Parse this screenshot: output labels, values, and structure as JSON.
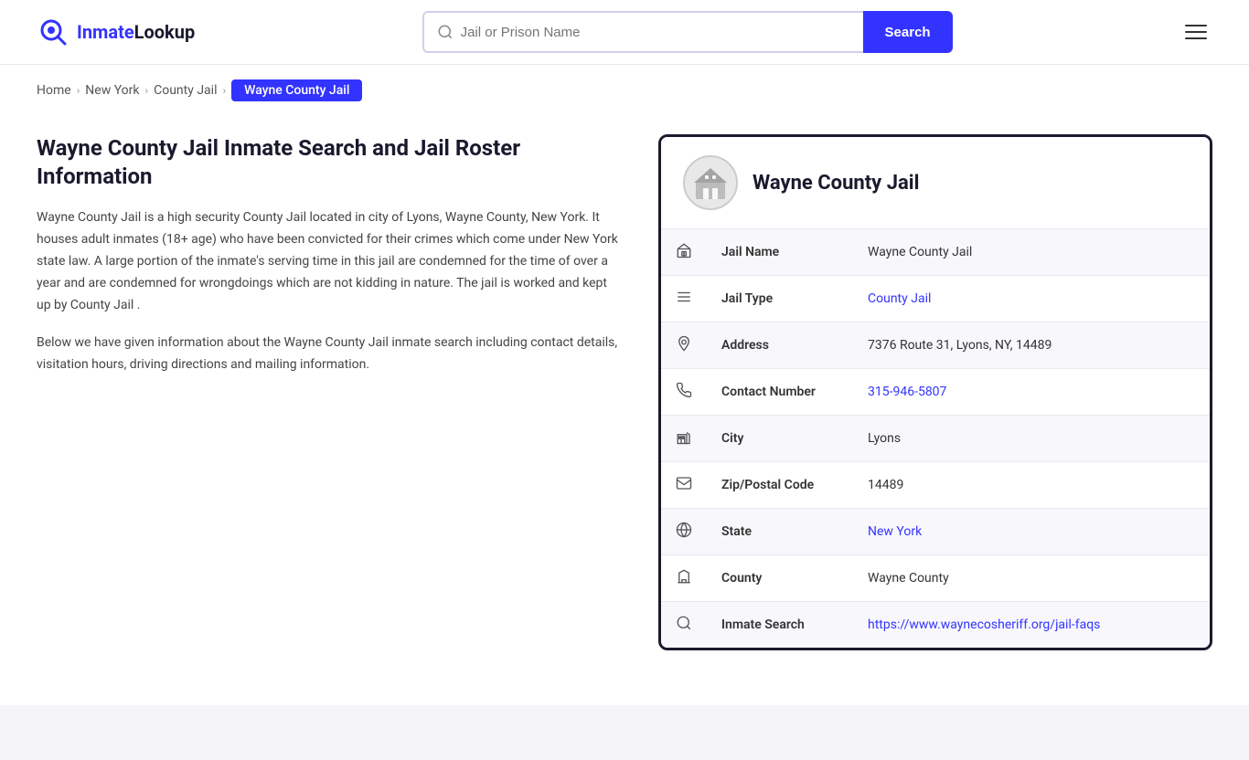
{
  "header": {
    "logo_text_blue": "Inmate",
    "logo_text_dark": "Lookup",
    "search_placeholder": "Jail or Prison Name",
    "search_button_label": "Search",
    "menu_icon": "menu-icon"
  },
  "breadcrumb": {
    "home_label": "Home",
    "state_label": "New York",
    "type_label": "County Jail",
    "current_label": "Wayne County Jail"
  },
  "left": {
    "title": "Wayne County Jail Inmate Search and Jail Roster Information",
    "desc1": "Wayne County Jail is a high security County Jail located in city of Lyons, Wayne County, New York. It houses adult inmates (18+ age) who have been convicted for their crimes which come under New York state law. A large portion of the inmate's serving time in this jail are condemned for the time of over a year and are condemned for wrongdoings which are not kidding in nature. The jail is worked and kept up by County Jail .",
    "desc2": "Below we have given information about the Wayne County Jail inmate search including contact details, visitation hours, driving directions and mailing information."
  },
  "card": {
    "jail_name_header": "Wayne County Jail",
    "rows": [
      {
        "label": "Jail Name",
        "value": "Wayne County Jail",
        "link": false,
        "icon": "jail-icon"
      },
      {
        "label": "Jail Type",
        "value": "County Jail",
        "link": true,
        "link_url": "#",
        "icon": "list-icon"
      },
      {
        "label": "Address",
        "value": "7376 Route 31, Lyons, NY, 14489",
        "link": false,
        "icon": "location-icon"
      },
      {
        "label": "Contact Number",
        "value": "315-946-5807",
        "link": true,
        "link_url": "tel:315-946-5807",
        "icon": "phone-icon"
      },
      {
        "label": "City",
        "value": "Lyons",
        "link": false,
        "icon": "city-icon"
      },
      {
        "label": "Zip/Postal Code",
        "value": "14489",
        "link": false,
        "icon": "mail-icon"
      },
      {
        "label": "State",
        "value": "New York",
        "link": true,
        "link_url": "#",
        "icon": "globe-icon"
      },
      {
        "label": "County",
        "value": "Wayne County",
        "link": false,
        "icon": "county-icon"
      },
      {
        "label": "Inmate Search",
        "value": "https://www.waynecosheriff.org/jail-faqs",
        "link": true,
        "link_url": "https://www.waynecosheriff.org/jail-faqs",
        "icon": "search-icon"
      }
    ]
  }
}
